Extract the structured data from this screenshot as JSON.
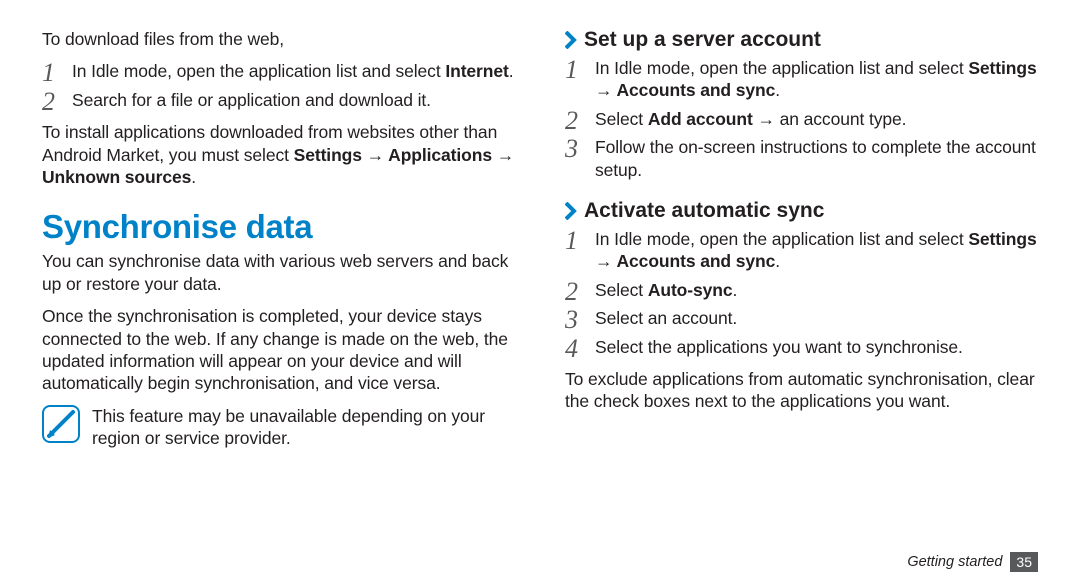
{
  "left": {
    "intro": "To download files from the web,",
    "steps": [
      {
        "pre": "In Idle mode, open the application list and select ",
        "bold": "Internet",
        "post": "."
      },
      {
        "pre": "Search for a file or application and download it.",
        "bold": "",
        "post": ""
      }
    ],
    "installText_pre": "To install applications downloaded from websites other than Android Market, you must select ",
    "installText_bold": "Settings → Applications → Unknown sources",
    "installText_post": ".",
    "h1": "Synchronise data",
    "p1": "You can synchronise data with various web servers and back up or restore your data.",
    "p2": "Once the synchronisation is completed, your device stays connected to the web. If any change is made on the web, the updated information will appear on your device and will automatically begin synchronisation, and vice versa.",
    "note": "This feature may be unavailable depending on your region or service provider."
  },
  "right": {
    "sub1": "Set up a server account",
    "steps1": [
      {
        "pre": "In Idle mode, open the application list and select ",
        "bold": "Settings → Accounts and sync",
        "post": "."
      },
      {
        "pre": "Select ",
        "bold": "Add account",
        "post": " → an account type."
      },
      {
        "pre": "Follow the on-screen instructions to complete the account setup.",
        "bold": "",
        "post": ""
      }
    ],
    "sub2": "Activate automatic sync",
    "steps2": [
      {
        "pre": "In Idle mode, open the application list and select ",
        "bold": "Settings → Accounts and sync",
        "post": "."
      },
      {
        "pre": "Select ",
        "bold": "Auto-sync",
        "post": "."
      },
      {
        "pre": "Select an account.",
        "bold": "",
        "post": ""
      },
      {
        "pre": "Select the applications you want to synchronise.",
        "bold": "",
        "post": ""
      }
    ],
    "exclude": "To exclude applications from automatic synchronisation, clear the check boxes next to the applications you want."
  },
  "footer": {
    "section": "Getting started",
    "page": "35"
  }
}
